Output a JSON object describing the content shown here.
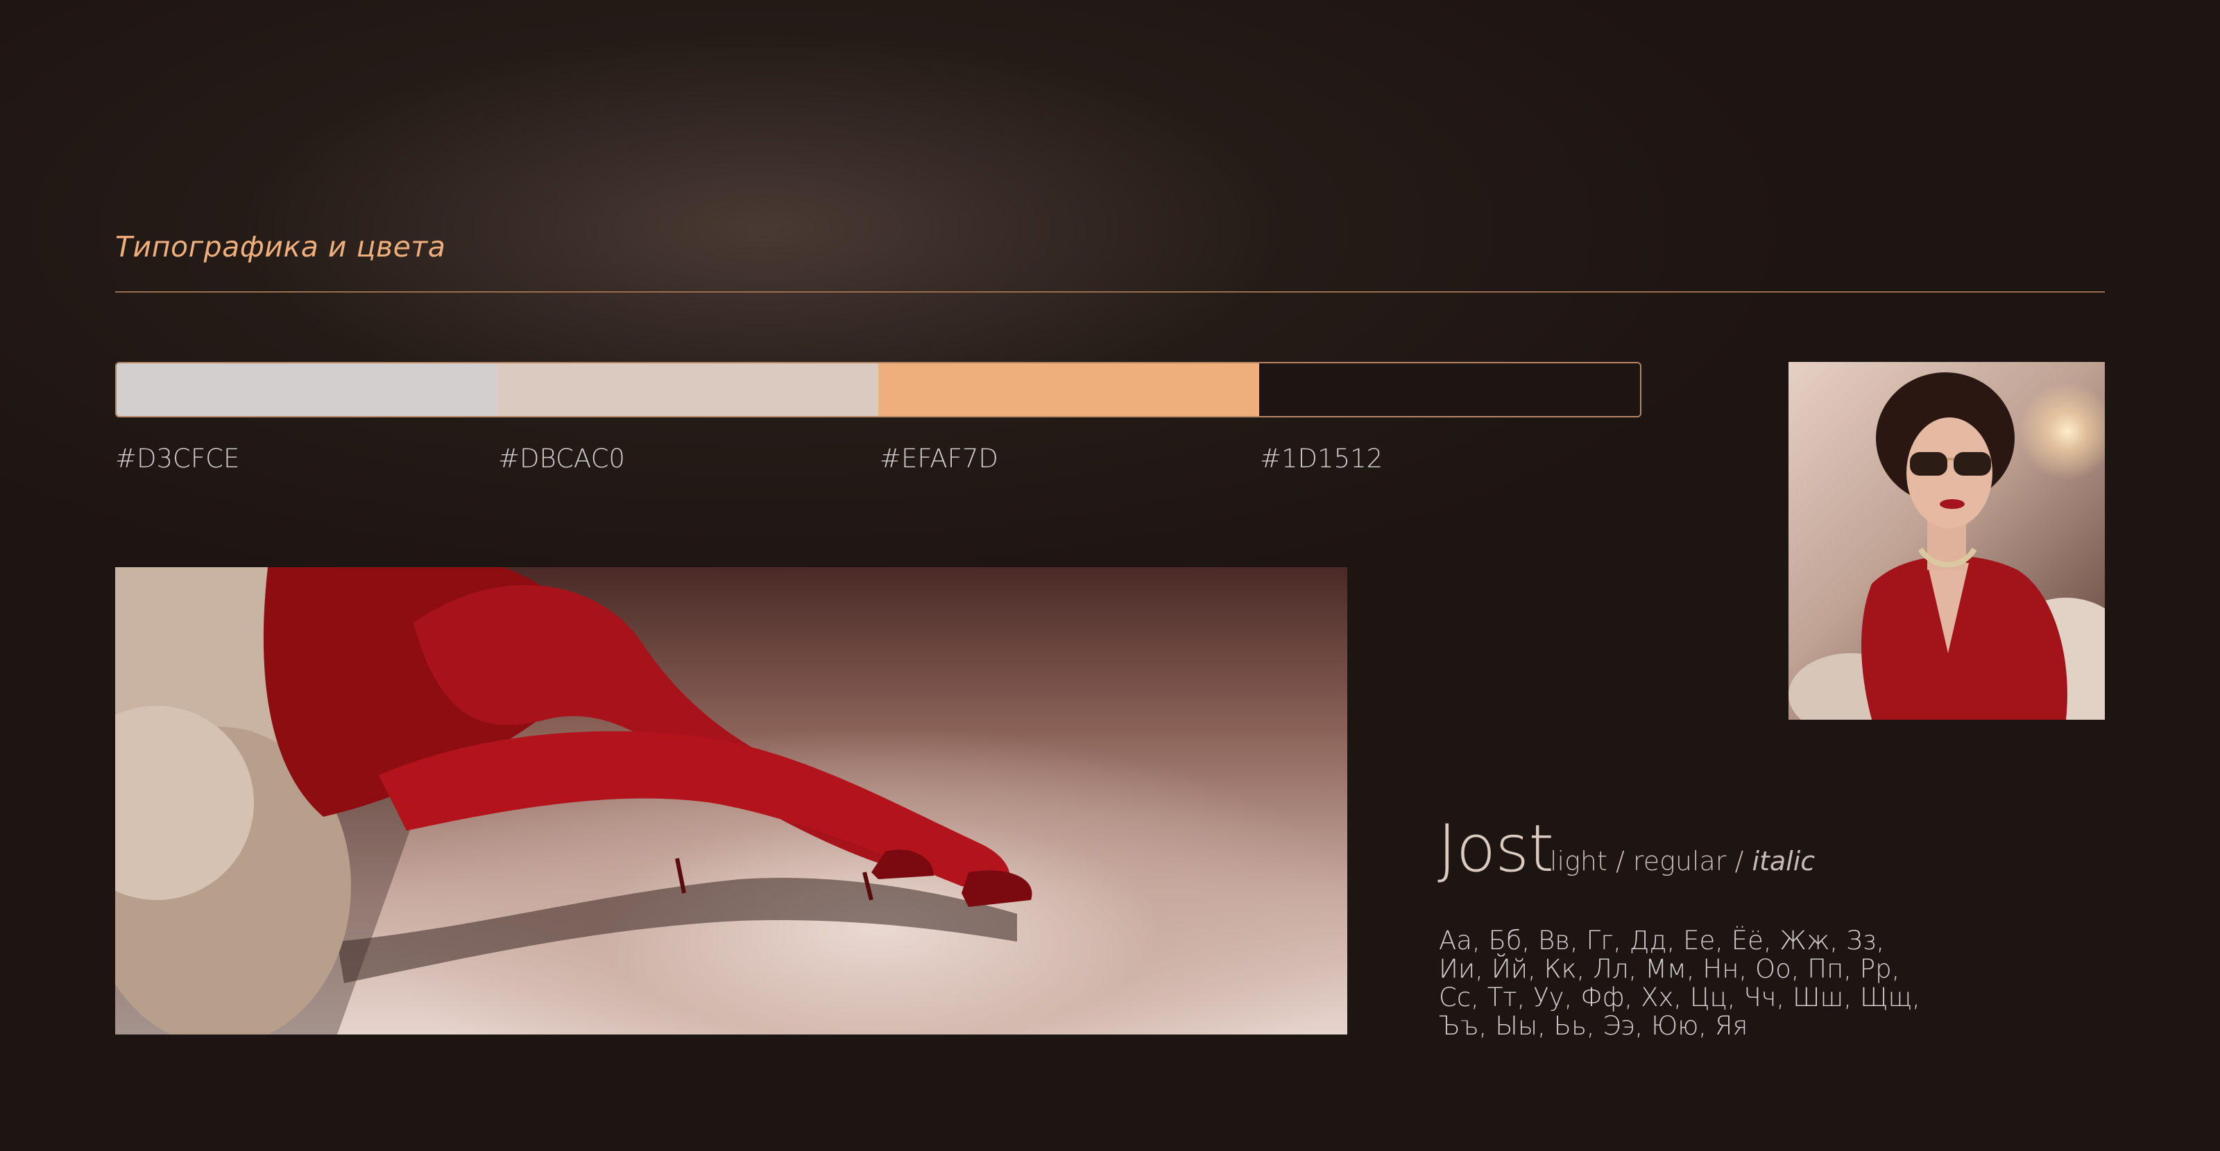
{
  "section": {
    "title": "Типографика и цвета"
  },
  "palette": [
    {
      "hex": "#D3CFCE",
      "color": "#D3CFCE"
    },
    {
      "hex": "#DBCAC0",
      "color": "#DBCAC0"
    },
    {
      "hex": "#EFAF7D",
      "color": "#EFAF7D"
    },
    {
      "hex": "#1D1512",
      "color": "#1D1512"
    }
  ],
  "typography": {
    "font_name": "Jost",
    "weight_light": "light",
    "separator": "/",
    "weight_regular": "regular",
    "weight_italic": "italic",
    "alphabet_lines": [
      "Аа, Бб, Вв, Гг, Дд, Ее, Ёё, Жж, Зз,",
      "Ии, Йй, Кк, Лл, Мм, Нн, Оо, Пп, Рр,",
      "Сс, Тт, Уу, Фф, Хх, Цц, Чч, Шш, Щщ,",
      "Ъъ, Ыы, Ьь, Ээ, Юю, Яя"
    ]
  },
  "colors": {
    "background": "#1D1512",
    "accent": "#EFAF7D",
    "divider": "#9A6D4F"
  }
}
